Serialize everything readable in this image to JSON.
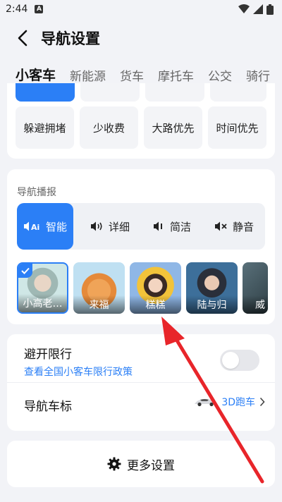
{
  "status": {
    "time": "2:44",
    "badge": "A"
  },
  "header": {
    "title": "导航设置"
  },
  "tabs": [
    "小客车",
    "新能源",
    "货车",
    "摩托车",
    "公交",
    "骑行"
  ],
  "route": {
    "options": [
      "躲避拥堵",
      "少收费",
      "大路优先",
      "时间优先"
    ]
  },
  "voice": {
    "section_label": "导航播报",
    "modes": [
      {
        "label": "智能",
        "icon": "speaker-ai-icon",
        "active": true
      },
      {
        "label": "详细",
        "icon": "speaker-loud-icon"
      },
      {
        "label": "简洁",
        "icon": "speaker-low-icon"
      },
      {
        "label": "静音",
        "icon": "speaker-mute-icon"
      }
    ],
    "voices": [
      "小高老…",
      "来福",
      "糕糕",
      "陆与归",
      "威"
    ]
  },
  "settings": {
    "restriction_title": "避开限行",
    "restriction_link": "查看全国小客车限行政策",
    "car_icon_title": "导航车标",
    "car_icon_value": "3D跑车"
  },
  "more": {
    "label": "更多设置"
  },
  "colors": {
    "accent": "#2b7ff6",
    "arrow": "#e8252a"
  }
}
